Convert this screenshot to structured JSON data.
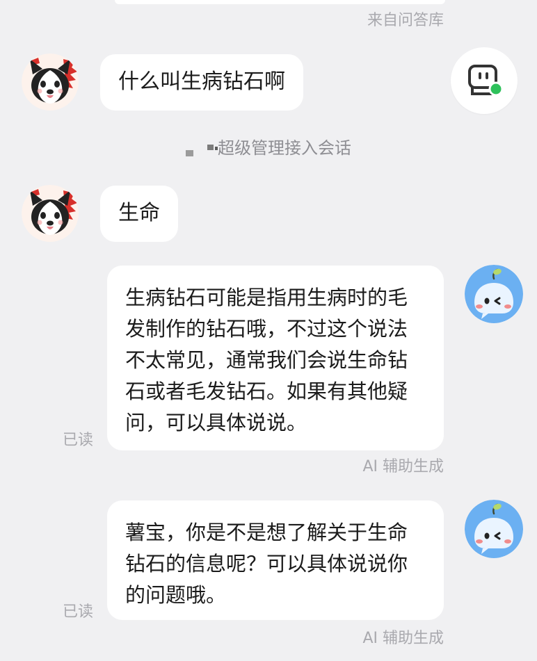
{
  "source_top": {
    "label": "来自问答库"
  },
  "messages": [
    {
      "role": "user",
      "text": "什么叫生病钻石啊"
    },
    {
      "role": "system",
      "text": "超级管理接入会话"
    },
    {
      "role": "user",
      "text": "生命"
    },
    {
      "role": "assistant",
      "lines": [
        "生病钻石可能是指用生病时的毛",
        "发制作的钻石哦，不过这个说法",
        "不太常见，通常我们会说生命钻",
        "石或者毛发钻石。如果有其他疑",
        "问，可以具体说说。"
      ],
      "read_status": "已读",
      "footer": "AI 辅助生成"
    },
    {
      "role": "assistant",
      "lines": [
        "薯宝，你是不是想了解关于生命",
        "钻石的信息呢？可以具体说说你",
        "的问题哦。"
      ],
      "read_status": "已读",
      "footer": "AI 辅助生成"
    }
  ],
  "icons": {
    "user_avatar": "husky-dog-avatar",
    "support_avatar": "robot-support-icon",
    "assistant_avatar": "blue-bot-avatar"
  },
  "colors": {
    "background": "#f0f0f2",
    "bubble": "#ffffff",
    "online_dot": "#2ec15b",
    "assistant_avatar": "#6bb0f2"
  }
}
